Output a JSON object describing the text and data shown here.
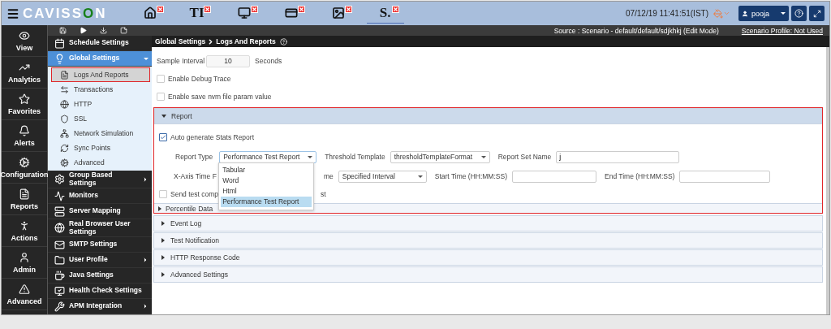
{
  "header": {
    "logo": {
      "start": "CAVISS",
      "accent": "O",
      "end": "N"
    },
    "tabs": [
      {
        "kind": "icon",
        "selected": false
      },
      {
        "kind": "text",
        "label": "TI",
        "selected": false
      },
      {
        "kind": "icon",
        "selected": false
      },
      {
        "kind": "icon",
        "selected": false
      },
      {
        "kind": "icon",
        "selected": false
      },
      {
        "kind": "text",
        "label": "S.",
        "selected": true
      }
    ],
    "datetime": "07/12/19 11:41:51(IST)",
    "user": "pooja"
  },
  "rail": [
    {
      "label": "View"
    },
    {
      "label": "Analytics"
    },
    {
      "label": "Favorites"
    },
    {
      "label": "Alerts"
    },
    {
      "label": "Configuration"
    },
    {
      "label": "Reports"
    },
    {
      "label": "Actions"
    },
    {
      "label": "Admin"
    },
    {
      "label": "Advanced"
    }
  ],
  "source": "Source : Scenario - default/default/sdjkhkj (Edit Mode)",
  "profile_link": "Scenario Profile: Not Used",
  "breadcrumb": {
    "parent": "Global Settings",
    "current": "Logs And Reports"
  },
  "tree": [
    {
      "label": "Schedule Settings",
      "selected": false,
      "has_submenu": false
    },
    {
      "label": "Global Settings",
      "selected": true,
      "expanded": true,
      "children": [
        {
          "label": "Logs And Reports",
          "selected": true
        },
        {
          "label": "Transactions",
          "selected": false
        },
        {
          "label": "HTTP",
          "selected": false
        },
        {
          "label": "SSL",
          "selected": false
        },
        {
          "label": "Network Simulation",
          "selected": false
        },
        {
          "label": "Sync Points",
          "selected": false
        },
        {
          "label": "Advanced",
          "selected": false
        }
      ]
    },
    {
      "label": "Group Based Settings",
      "selected": false,
      "has_submenu": true
    },
    {
      "label": "Monitors",
      "selected": false,
      "has_submenu": false
    },
    {
      "label": "Server Mapping",
      "selected": false,
      "has_submenu": false
    },
    {
      "label": "Real Browser User Settings",
      "selected": false,
      "has_submenu": false
    },
    {
      "label": "SMTP Settings",
      "selected": false,
      "has_submenu": false
    },
    {
      "label": "User Profile",
      "selected": false,
      "has_submenu": true
    },
    {
      "label": "Java Settings",
      "selected": false,
      "has_submenu": false
    },
    {
      "label": "Health Check Settings",
      "selected": false,
      "has_submenu": false
    },
    {
      "label": "APM Integration",
      "selected": false,
      "has_submenu": true
    }
  ],
  "form": {
    "sample_interval": {
      "label": "Sample Interval",
      "value": "10",
      "unit": "Seconds"
    },
    "checks": [
      {
        "label": "Enable Debug Trace",
        "checked": false
      },
      {
        "label": "Enable save nvm file param value",
        "checked": false
      }
    ]
  },
  "report": {
    "title": "Report",
    "expanded": true,
    "auto_generate": {
      "label": "Auto generate Stats Report",
      "checked": true
    },
    "report_type": {
      "label": "Report Type",
      "value": "Performance Test Report",
      "open": true,
      "options": [
        {
          "label": "Tabular",
          "selected": false
        },
        {
          "label": "Word",
          "selected": false
        },
        {
          "label": "Html",
          "selected": false
        },
        {
          "label": "Performance Test Report",
          "selected": true
        }
      ]
    },
    "threshold_template": {
      "label": "Threshold Template",
      "value": "thresholdTemplateFormat"
    },
    "report_set_name": {
      "label": "Report Set Name",
      "value": "j"
    },
    "x_axis_label": "X-Axis Time F",
    "time_label_end": "me",
    "time_mode": {
      "value": "Specified Interval"
    },
    "start_time": {
      "label": "Start Time (HH:MM:SS)"
    },
    "end_time": {
      "label": "End Time (HH:MM:SS)"
    },
    "send_test": {
      "label_start": "Send test comp",
      "label_end": "st",
      "checked": false
    },
    "sub_sections": [
      {
        "title": "Percentile Data",
        "expanded": false
      }
    ]
  },
  "sections": [
    {
      "title": "Event Log",
      "expanded": false
    },
    {
      "title": "Test Notification",
      "expanded": false
    },
    {
      "title": "HTTP Response Code",
      "expanded": false
    },
    {
      "title": "Advanced Settings",
      "expanded": false
    }
  ]
}
